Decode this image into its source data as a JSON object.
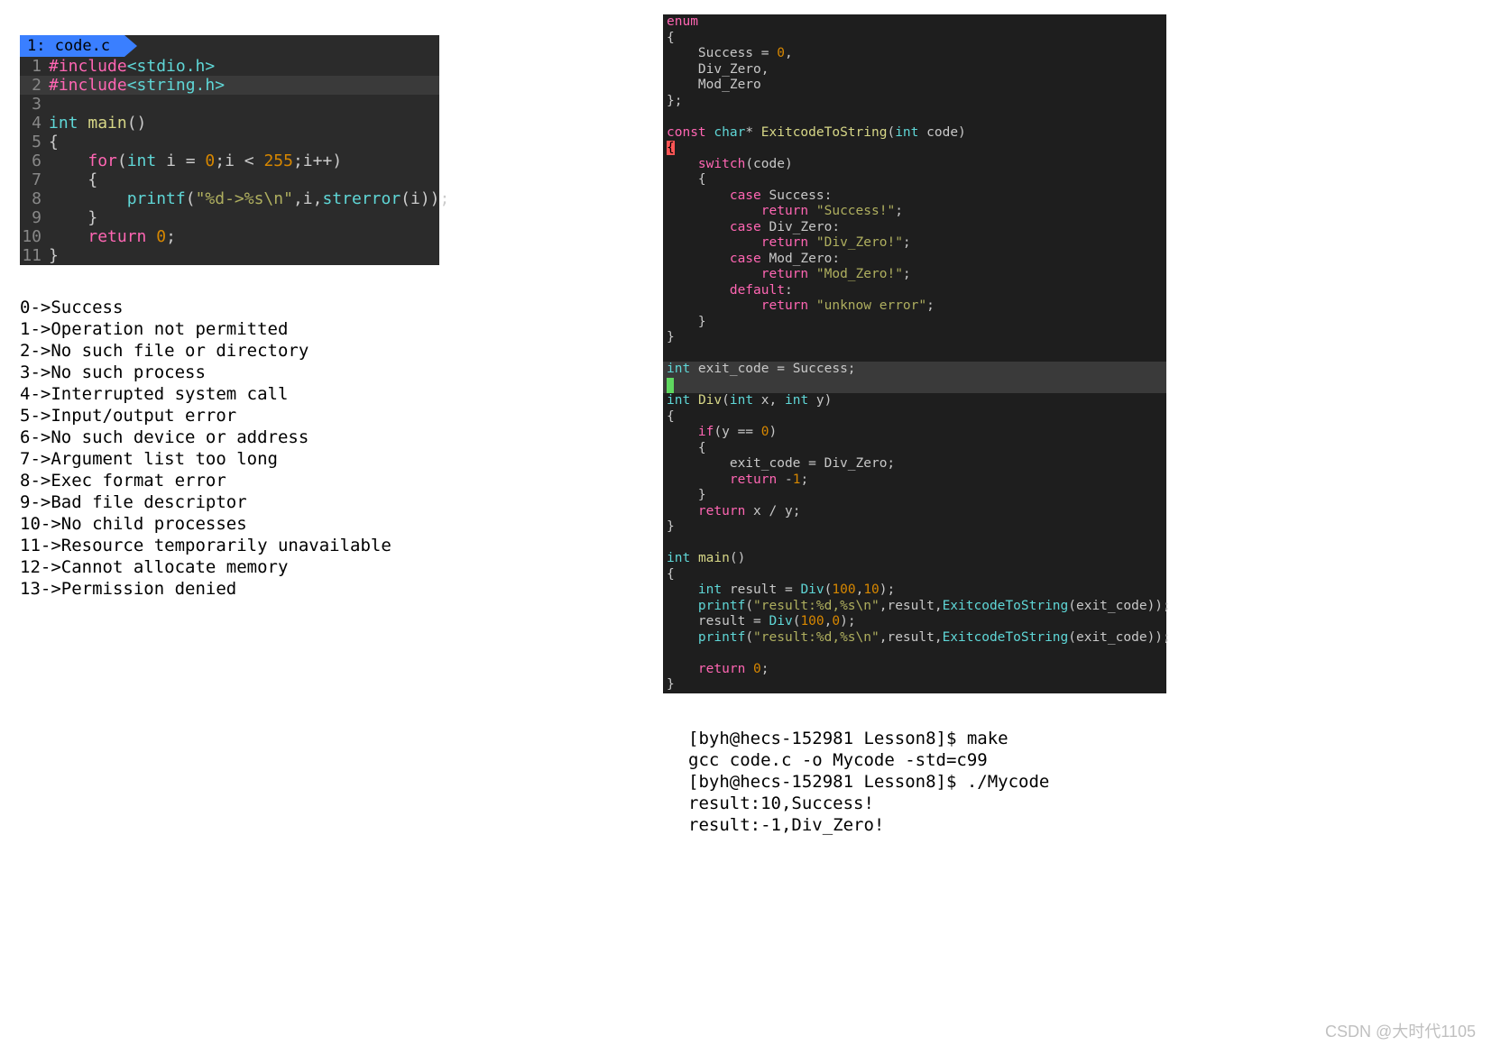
{
  "tab": "1: code.c",
  "editor1": [
    {
      "n": "1",
      "html": "<span class='kw-pink'>#include</span><span class='kw-cyan'>&lt;stdio.h&gt;</span>"
    },
    {
      "n": "2",
      "hl": true,
      "html": "<span class='kw-pink'>#include</span><span class='kw-cyan'>&lt;string.h&gt;</span>"
    },
    {
      "n": "3",
      "html": ""
    },
    {
      "n": "4",
      "html": "<span class='kw-cyan'>int</span> <span class='kw-yellow'>main</span>()"
    },
    {
      "n": "5",
      "html": "{"
    },
    {
      "n": "6",
      "html": "    <span class='kw-pink'>for</span>(<span class='kw-cyan'>int</span> i = <span class='kw-orange'>0</span>;i &lt; <span class='kw-orange'>255</span>;i++)"
    },
    {
      "n": "7",
      "html": "    {"
    },
    {
      "n": "8",
      "html": "        <span class='kw-cyan'>printf</span>(<span class='kw-olive'>\"%d-&gt;%s\\n\"</span>,i,<span class='kw-cyan'>strerror</span>(i));"
    },
    {
      "n": "9",
      "html": "    }"
    },
    {
      "n": "10",
      "html": "    <span class='kw-pink'>return</span> <span class='kw-orange'>0</span>;"
    },
    {
      "n": "11",
      "html": "}"
    }
  ],
  "output": [
    "0->Success",
    "1->Operation not permitted",
    "2->No such file or directory",
    "3->No such process",
    "4->Interrupted system call",
    "5->Input/output error",
    "6->No such device or address",
    "7->Argument list too long",
    "8->Exec format error",
    "9->Bad file descriptor",
    "10->No child processes",
    "11->Resource temporarily unavailable",
    "12->Cannot allocate memory",
    "13->Permission denied"
  ],
  "editor2": [
    {
      "html": "<span class='kw-pink'>enum</span>"
    },
    {
      "html": "{"
    },
    {
      "html": "    Success = <span class='kw-orange'>0</span>,"
    },
    {
      "html": "    Div_Zero,"
    },
    {
      "html": "    Mod_Zero"
    },
    {
      "html": "};"
    },
    {
      "html": ""
    },
    {
      "html": "<span class='kw-pink'>const</span> <span class='kw-cyan'>char</span>* <span class='kw-yellow'>ExitcodeToString</span>(<span class='kw-cyan'>int</span> code)"
    },
    {
      "html": "<span style='background:#ff5555;color:#000'>{</span>"
    },
    {
      "html": "    <span class='kw-pink'>switch</span>(code)"
    },
    {
      "html": "    {"
    },
    {
      "html": "        <span class='kw-pink'>case</span> Success:"
    },
    {
      "html": "            <span class='kw-pink'>return</span> <span class='kw-olive'>\"Success!\"</span>;"
    },
    {
      "html": "        <span class='kw-pink'>case</span> Div_Zero:"
    },
    {
      "html": "            <span class='kw-pink'>return</span> <span class='kw-olive'>\"Div_Zero!\"</span>;"
    },
    {
      "html": "        <span class='kw-pink'>case</span> Mod_Zero:"
    },
    {
      "html": "            <span class='kw-pink'>return</span> <span class='kw-olive'>\"Mod_Zero!\"</span>;"
    },
    {
      "html": "        <span class='kw-pink'>default</span>:"
    },
    {
      "html": "            <span class='kw-pink'>return</span> <span class='kw-olive'>\"unknow error\"</span>;"
    },
    {
      "html": "    }"
    },
    {
      "html": "}"
    },
    {
      "html": ""
    },
    {
      "hl": true,
      "html": "<span class='kw-cyan'>int</span> exit_code = Success;"
    },
    {
      "hl": true,
      "html": "<span class='cursor-box'> </span>"
    },
    {
      "html": "<span class='kw-cyan'>int</span> <span class='kw-yellow'>Div</span>(<span class='kw-cyan'>int</span> x, <span class='kw-cyan'>int</span> y)"
    },
    {
      "html": "{"
    },
    {
      "html": "    <span class='kw-pink'>if</span>(y == <span class='kw-orange'>0</span>)"
    },
    {
      "html": "    {"
    },
    {
      "html": "        exit_code = Div_Zero;"
    },
    {
      "html": "        <span class='kw-pink'>return</span> -<span class='kw-orange'>1</span>;"
    },
    {
      "html": "    }"
    },
    {
      "html": "    <span class='kw-pink'>return</span> x / y;"
    },
    {
      "html": "}"
    },
    {
      "html": ""
    },
    {
      "html": "<span class='kw-cyan'>int</span> <span class='kw-yellow'>main</span>()"
    },
    {
      "html": "{"
    },
    {
      "html": "    <span class='kw-cyan'>int</span> result = <span class='kw-cyan'>Div</span>(<span class='kw-orange'>100</span>,<span class='kw-orange'>10</span>);"
    },
    {
      "html": "    <span class='kw-cyan'>printf</span>(<span class='kw-olive'>\"result:%d,%s\\n\"</span>,result,<span class='kw-cyan'>ExitcodeToString</span>(exit_code));"
    },
    {
      "html": "    result = <span class='kw-cyan'>Div</span>(<span class='kw-orange'>100</span>,<span class='kw-orange'>0</span>);"
    },
    {
      "html": "    <span class='kw-cyan'>printf</span>(<span class='kw-olive'>\"result:%d,%s\\n\"</span>,result,<span class='kw-cyan'>ExitcodeToString</span>(exit_code));"
    },
    {
      "html": ""
    },
    {
      "html": "    <span class='kw-pink'>return</span> <span class='kw-orange'>0</span>;"
    },
    {
      "html": "}"
    }
  ],
  "terminal": [
    "[byh@hecs-152981 Lesson8]$ make",
    "gcc code.c -o Mycode -std=c99",
    "[byh@hecs-152981 Lesson8]$ ./Mycode",
    "result:10,Success!",
    "result:-1,Div_Zero!"
  ],
  "watermark": "CSDN @大时代1105"
}
